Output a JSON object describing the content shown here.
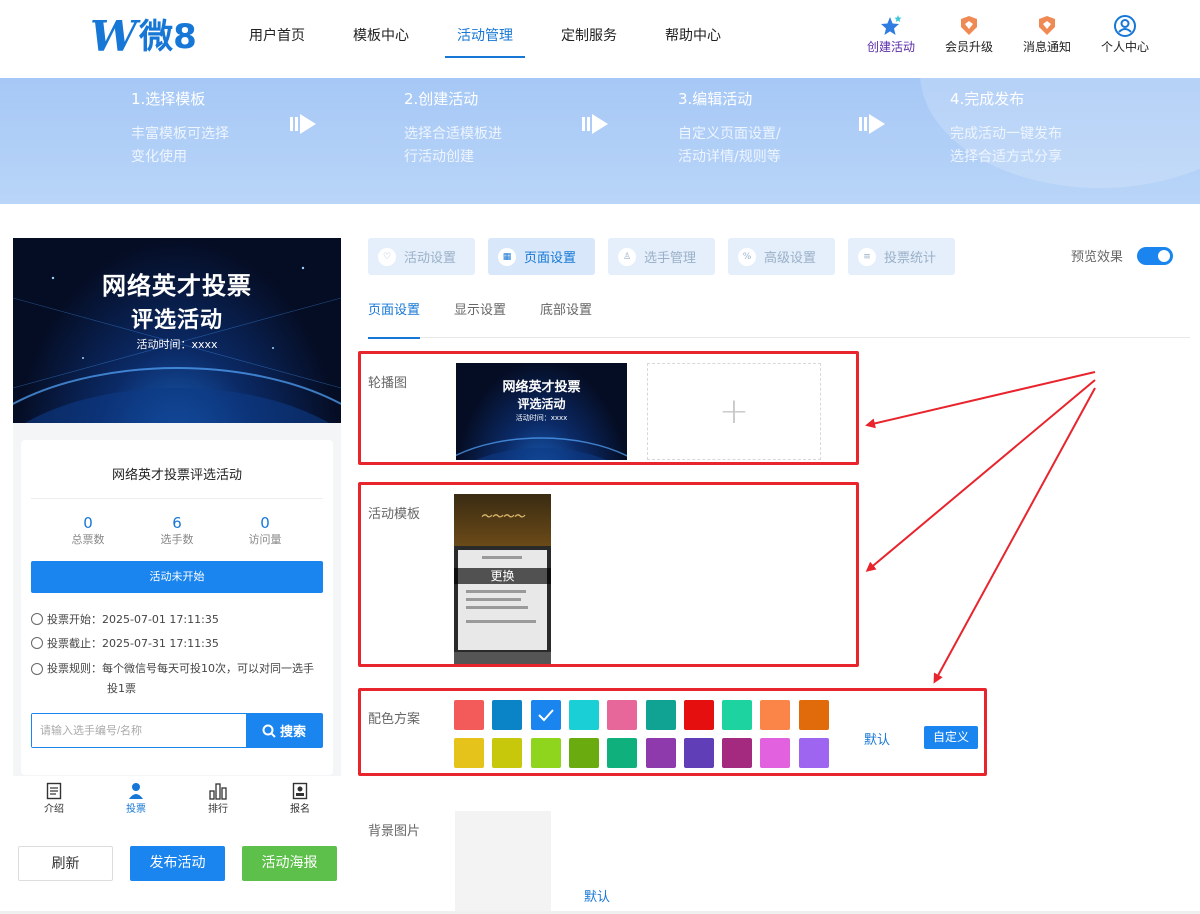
{
  "header": {
    "logo_text": "微8",
    "nav": [
      {
        "label": "用户首页",
        "active": false
      },
      {
        "label": "模板中心",
        "active": false
      },
      {
        "label": "活动管理",
        "active": true
      },
      {
        "label": "定制服务",
        "active": false
      },
      {
        "label": "帮助中心",
        "active": false
      }
    ],
    "actions": [
      {
        "label": "创建活动",
        "icon": "stars-icon"
      },
      {
        "label": "会员升级",
        "icon": "crown-icon"
      },
      {
        "label": "消息通知",
        "icon": "bell-icon"
      },
      {
        "label": "个人中心",
        "icon": "user-icon"
      }
    ]
  },
  "steps": [
    {
      "title": "1.选择模板",
      "desc1": "丰富模板可选择",
      "desc2": "变化使用"
    },
    {
      "title": "2.创建活动",
      "desc1": "选择合适模板进",
      "desc2": "行活动创建"
    },
    {
      "title": "3.编辑活动",
      "desc1": "自定义页面设置/",
      "desc2": "活动详情/规则等"
    },
    {
      "title": "4.完成发布",
      "desc1": "完成活动一键发布",
      "desc2": "选择合适方式分享"
    }
  ],
  "preview": {
    "hero_title_1": "网络英才投票",
    "hero_title_2": "评选活动",
    "hero_time": "活动时间：xxxx",
    "card_title": "网络英才投票评选活动",
    "stats": [
      {
        "value": "0",
        "label": "总票数"
      },
      {
        "value": "6",
        "label": "选手数"
      },
      {
        "value": "0",
        "label": "访问量"
      }
    ],
    "status_label": "活动未开始",
    "vote_start": "投票开始：2025-07-01 17:11:35",
    "vote_end": "投票截止：2025-07-31 17:11:35",
    "vote_rule_1": "投票规则：每个微信号每天可投10次，可以对同一选手",
    "vote_rule_2": "投1票",
    "search_placeholder": "请输入选手编号/名称",
    "search_label": "搜索",
    "tabbar": [
      {
        "label": "介绍",
        "icon": "document-icon",
        "active": false
      },
      {
        "label": "投票",
        "icon": "person-icon",
        "active": true
      },
      {
        "label": "排行",
        "icon": "bar-chart-icon",
        "active": false
      },
      {
        "label": "报名",
        "icon": "signup-icon",
        "active": false
      }
    ]
  },
  "bottom_buttons": {
    "refresh": "刷新",
    "publish": "发布活动",
    "poster": "活动海报"
  },
  "settings": {
    "tabs": [
      {
        "label": "活动设置",
        "active": false
      },
      {
        "label": "页面设置",
        "active": true
      },
      {
        "label": "选手管理",
        "active": false
      },
      {
        "label": "高级设置",
        "active": false
      },
      {
        "label": "投票统计",
        "active": false
      }
    ],
    "preview_toggle_label": "预览效果",
    "preview_toggle_on": true,
    "subtabs": [
      {
        "label": "页面设置",
        "active": true
      },
      {
        "label": "显示设置",
        "active": false
      },
      {
        "label": "底部设置",
        "active": false
      }
    ],
    "carousel_label": "轮播图",
    "carousel_thumb_1": "网络英才投票",
    "carousel_thumb_2": "评选活动",
    "carousel_thumb_3": "活动时间：xxxx",
    "carousel_add": "+",
    "template_label": "活动模板",
    "template_change": "更换",
    "color_label": "配色方案",
    "colors_row1": [
      "#f35b5b",
      "#0a84c6",
      "#1a85ef",
      "#1ad0d6",
      "#e8679a",
      "#10a394",
      "#e50f0f",
      "#1dd4a0",
      "#fb8448",
      "#e16b0b"
    ],
    "colors_row2": [
      "#e5c31a",
      "#c7c70b",
      "#8fd41d",
      "#6aac10",
      "#10b07c",
      "#8e3aad",
      "#5f3eb8",
      "#a32a7e",
      "#e261de",
      "#9d65f0"
    ],
    "selected_color_index": 2,
    "color_default": "默认",
    "color_custom": "自定义",
    "bg_label": "背景图片",
    "bg_default": "默认"
  },
  "colors": {
    "accent": "#1677d6",
    "annotation_red": "#e8242d"
  }
}
